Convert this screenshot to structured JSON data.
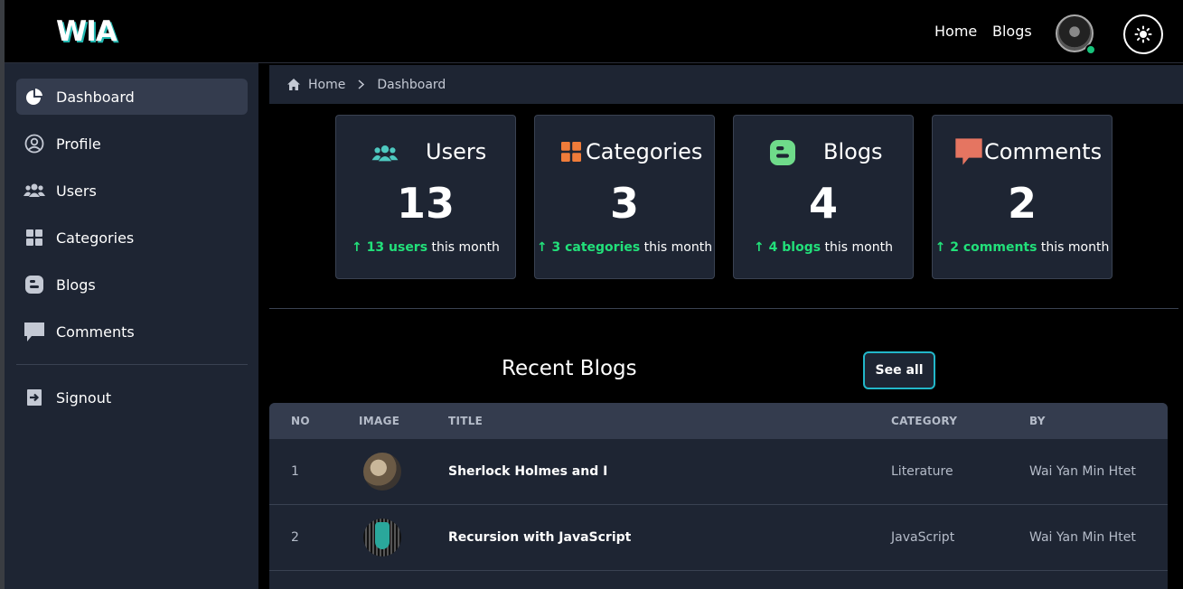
{
  "topbar": {
    "logo": "WIA",
    "nav": [
      {
        "label": "Home"
      },
      {
        "label": "Blogs"
      }
    ]
  },
  "sidebar": {
    "items": [
      {
        "label": "Dashboard",
        "icon": "pie-chart-icon"
      },
      {
        "label": "Profile",
        "icon": "user-circle-icon"
      },
      {
        "label": "Users",
        "icon": "users-icon"
      },
      {
        "label": "Categories",
        "icon": "grid-icon"
      },
      {
        "label": "Blogs",
        "icon": "blogger-icon"
      },
      {
        "label": "Comments",
        "icon": "comment-icon"
      }
    ],
    "signout": {
      "label": "Signout",
      "icon": "signout-icon"
    }
  },
  "breadcrumb": {
    "home": "Home",
    "current": "Dashboard"
  },
  "stats": [
    {
      "title": "Users",
      "value": "13",
      "highlight": "13 users",
      "suffix": "this month",
      "icon_color": "#4ec9c0"
    },
    {
      "title": "Categories",
      "value": "3",
      "highlight": "3 categories",
      "suffix": "this month",
      "icon_color": "#f07c3a"
    },
    {
      "title": "Blogs",
      "value": "4",
      "highlight": "4 blogs",
      "suffix": "this month",
      "icon_color": "#6fdb8a"
    },
    {
      "title": "Comments",
      "value": "2",
      "highlight": "2 comments",
      "suffix": "this month",
      "icon_color": "#e57561"
    }
  ],
  "recent": {
    "title": "Recent Blogs",
    "see_all": "See all",
    "columns": [
      "NO",
      "IMAGE",
      "TITLE",
      "CATEGORY",
      "BY"
    ],
    "rows": [
      {
        "no": "1",
        "title": "Sherlock Holmes and I",
        "category": "Literature",
        "by": "Wai Yan Min Htet"
      },
      {
        "no": "2",
        "title": "Recursion with JavaScript",
        "category": "JavaScript",
        "by": "Wai Yan Min Htet"
      }
    ]
  },
  "colors": {
    "accent_green": "#22e07a",
    "accent_teal": "#22b7c9",
    "panel": "#1e2533",
    "panel_active": "#343c4e"
  }
}
